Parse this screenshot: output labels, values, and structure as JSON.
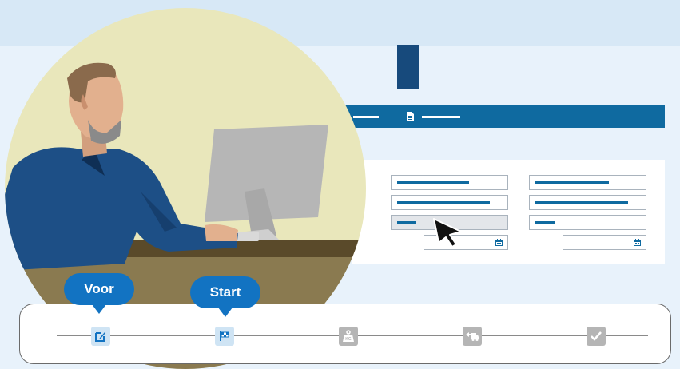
{
  "bubbles": {
    "voor": "Voor",
    "start": "Start"
  },
  "steps": [
    {
      "icon": "edit-icon",
      "state": "active"
    },
    {
      "icon": "checkered-flag-icon",
      "state": "active"
    },
    {
      "icon": "weight-kg-icon",
      "state": "inactive"
    },
    {
      "icon": "truck-unload-icon",
      "state": "inactive"
    },
    {
      "icon": "checkmark-icon",
      "state": "inactive"
    }
  ],
  "weight_icon_text": "KG",
  "colors": {
    "accent": "#1273c2",
    "navbar": "#0f6aa0",
    "logo": "#174a7c",
    "inactive_step": "#b5b5b5"
  }
}
